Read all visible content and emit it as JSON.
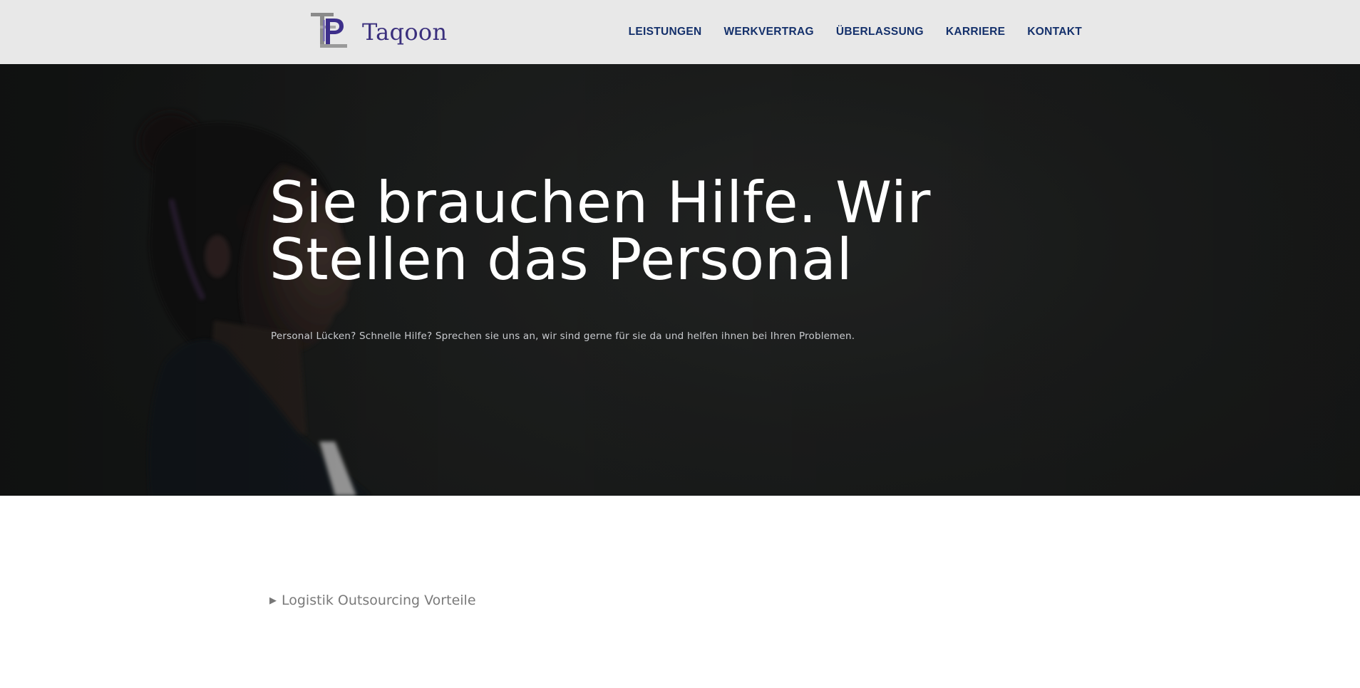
{
  "brand": {
    "name": "Taqoon",
    "logo_icon": "tp-monogram-logo"
  },
  "nav": {
    "items": [
      {
        "label": "LEISTUNGEN"
      },
      {
        "label": "WERKVERTRAG"
      },
      {
        "label": "ÜBERLASSUNG"
      },
      {
        "label": "KARRIERE"
      },
      {
        "label": "KONTAKT"
      }
    ]
  },
  "hero": {
    "title_line1": "Sie brauchen Hilfe. Wir",
    "title_line2": "Stellen das Personal",
    "subtitle": "Personal Lücken? Schnelle Hilfe? Sprechen sie uns an, wir sind gerne für sie da und helfen ihnen bei Ihren Problemen."
  },
  "accordion": {
    "icon": "triangle-right-icon",
    "label": "Logistik Outsourcing Vorteile"
  },
  "colors": {
    "header_bg": "#e8e8e8",
    "nav_text": "#14306b",
    "brand_text": "#3a2f7d",
    "hero_bg": "#232524"
  }
}
